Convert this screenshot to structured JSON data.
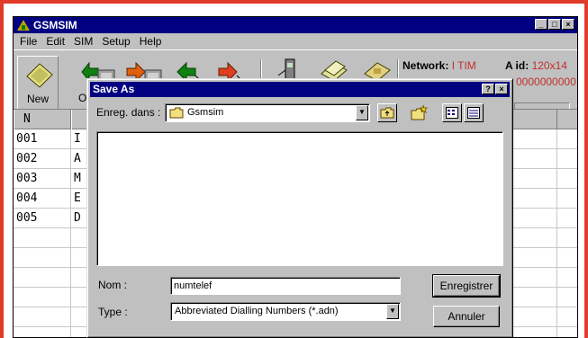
{
  "app": {
    "title": "GSMSIM",
    "menu": [
      "File",
      "Edit",
      "SIM",
      "Setup",
      "Help"
    ],
    "toolbar": {
      "new_label": "New",
      "open_label": "O",
      "network_label": "Network:",
      "network_value": "I TIM",
      "aid_label": "A id:",
      "aid_value": "120x14",
      "code_value": "0000000000"
    },
    "table": {
      "header_n": "N",
      "header_col2": "",
      "rows": [
        {
          "n": "001",
          "c": "I"
        },
        {
          "n": "002",
          "c": "A"
        },
        {
          "n": "003",
          "c": "M"
        },
        {
          "n": "004",
          "c": "E"
        },
        {
          "n": "005",
          "c": "D"
        }
      ]
    }
  },
  "dialog": {
    "title": "Save As",
    "look_in_label": "Enreg. dans :",
    "look_in_value": "Gsmsim",
    "filename_label": "Nom :",
    "filename_value": "numtelef",
    "type_label": "Type :",
    "type_value": "Abbreviated Dialling Numbers (*.adn)",
    "save_label": "Enregistrer",
    "cancel_label": "Annuler",
    "help_btn": "?",
    "close_btn": "×"
  },
  "colors": {
    "frame": "#e03a2a",
    "titlebar": "#000080",
    "face": "#c0c0c0",
    "accent_red": "#c03030"
  }
}
